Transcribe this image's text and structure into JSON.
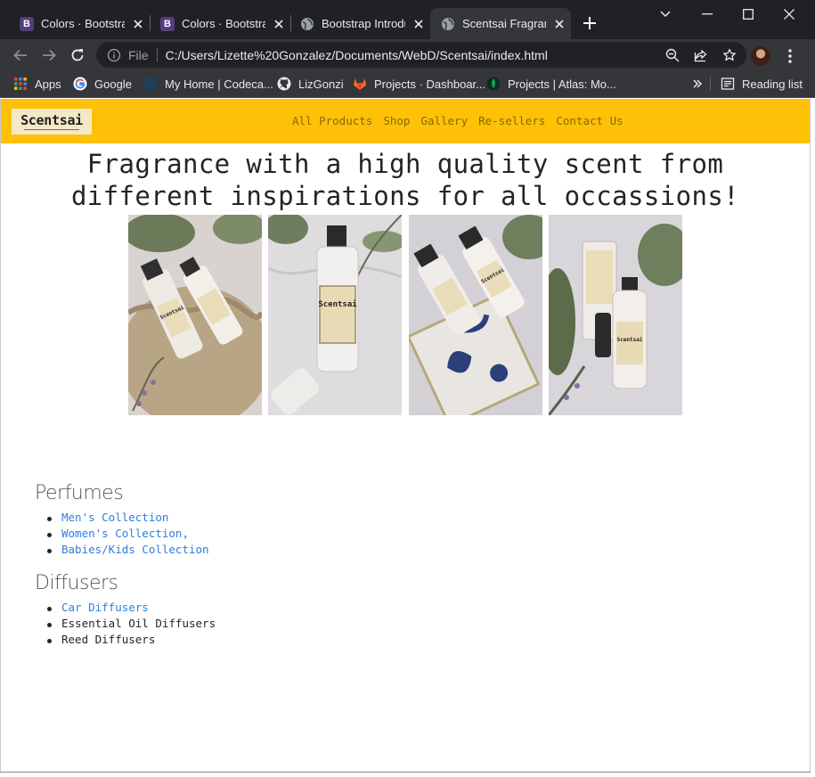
{
  "browser": {
    "tabs": [
      {
        "title": "Colors · Bootstrap",
        "favicon": "bootstrap-icon",
        "active": false
      },
      {
        "title": "Colors · Bootstrap",
        "favicon": "bootstrap-icon",
        "active": false
      },
      {
        "title": "Bootstrap Introduction",
        "favicon": "globe-icon",
        "active": false
      },
      {
        "title": "Scentsai Fragrance",
        "favicon": "globe-icon",
        "active": true
      }
    ],
    "favicon_letter": "B",
    "omnibox": {
      "scheme_label": "File",
      "url": "C:/Users/Lizette%20Gonzalez/Documents/WebD/Scentsai/index.html"
    },
    "bookmarks": [
      {
        "label": "Apps",
        "icon": "apps-grid-icon"
      },
      {
        "label": "Google",
        "icon": "google-icon"
      },
      {
        "label": "My Home | Codeca...",
        "icon": "codecademy-icon"
      },
      {
        "label": "LizGonzi",
        "icon": "github-icon"
      },
      {
        "label": "Projects · Dashboar...",
        "icon": "gitlab-icon"
      },
      {
        "label": "Projects | Atlas: Mo...",
        "icon": "mongodb-leaf-icon"
      }
    ],
    "reading_list": "Reading list"
  },
  "site": {
    "brand": "Scentsai",
    "nav": [
      "All Products",
      "Shop",
      "Gallery",
      "Re-sellers",
      "Contact Us"
    ],
    "hero_line1": "Fragrance with a high quality scent from",
    "hero_line2": "different inspirations for all occassions!",
    "photo_label": "Scentsai",
    "sections": [
      {
        "heading": "Perfumes",
        "items": [
          {
            "label": "Men's Collection",
            "link": true
          },
          {
            "label": "Women's Collection,",
            "link": true
          },
          {
            "label": "Babies/Kids Collection",
            "link": true
          }
        ]
      },
      {
        "heading": "Diffusers",
        "items": [
          {
            "label": "Car Diffusers",
            "link": true
          },
          {
            "label": "Essential Oil Diffusers",
            "link": false
          },
          {
            "label": "Reed Diffusers",
            "link": false
          }
        ]
      }
    ]
  },
  "colors": {
    "navbar": "#ffc107",
    "link": "#2f7de1",
    "chrome_dark": "#202124",
    "chrome_toolbar": "#35363a"
  }
}
